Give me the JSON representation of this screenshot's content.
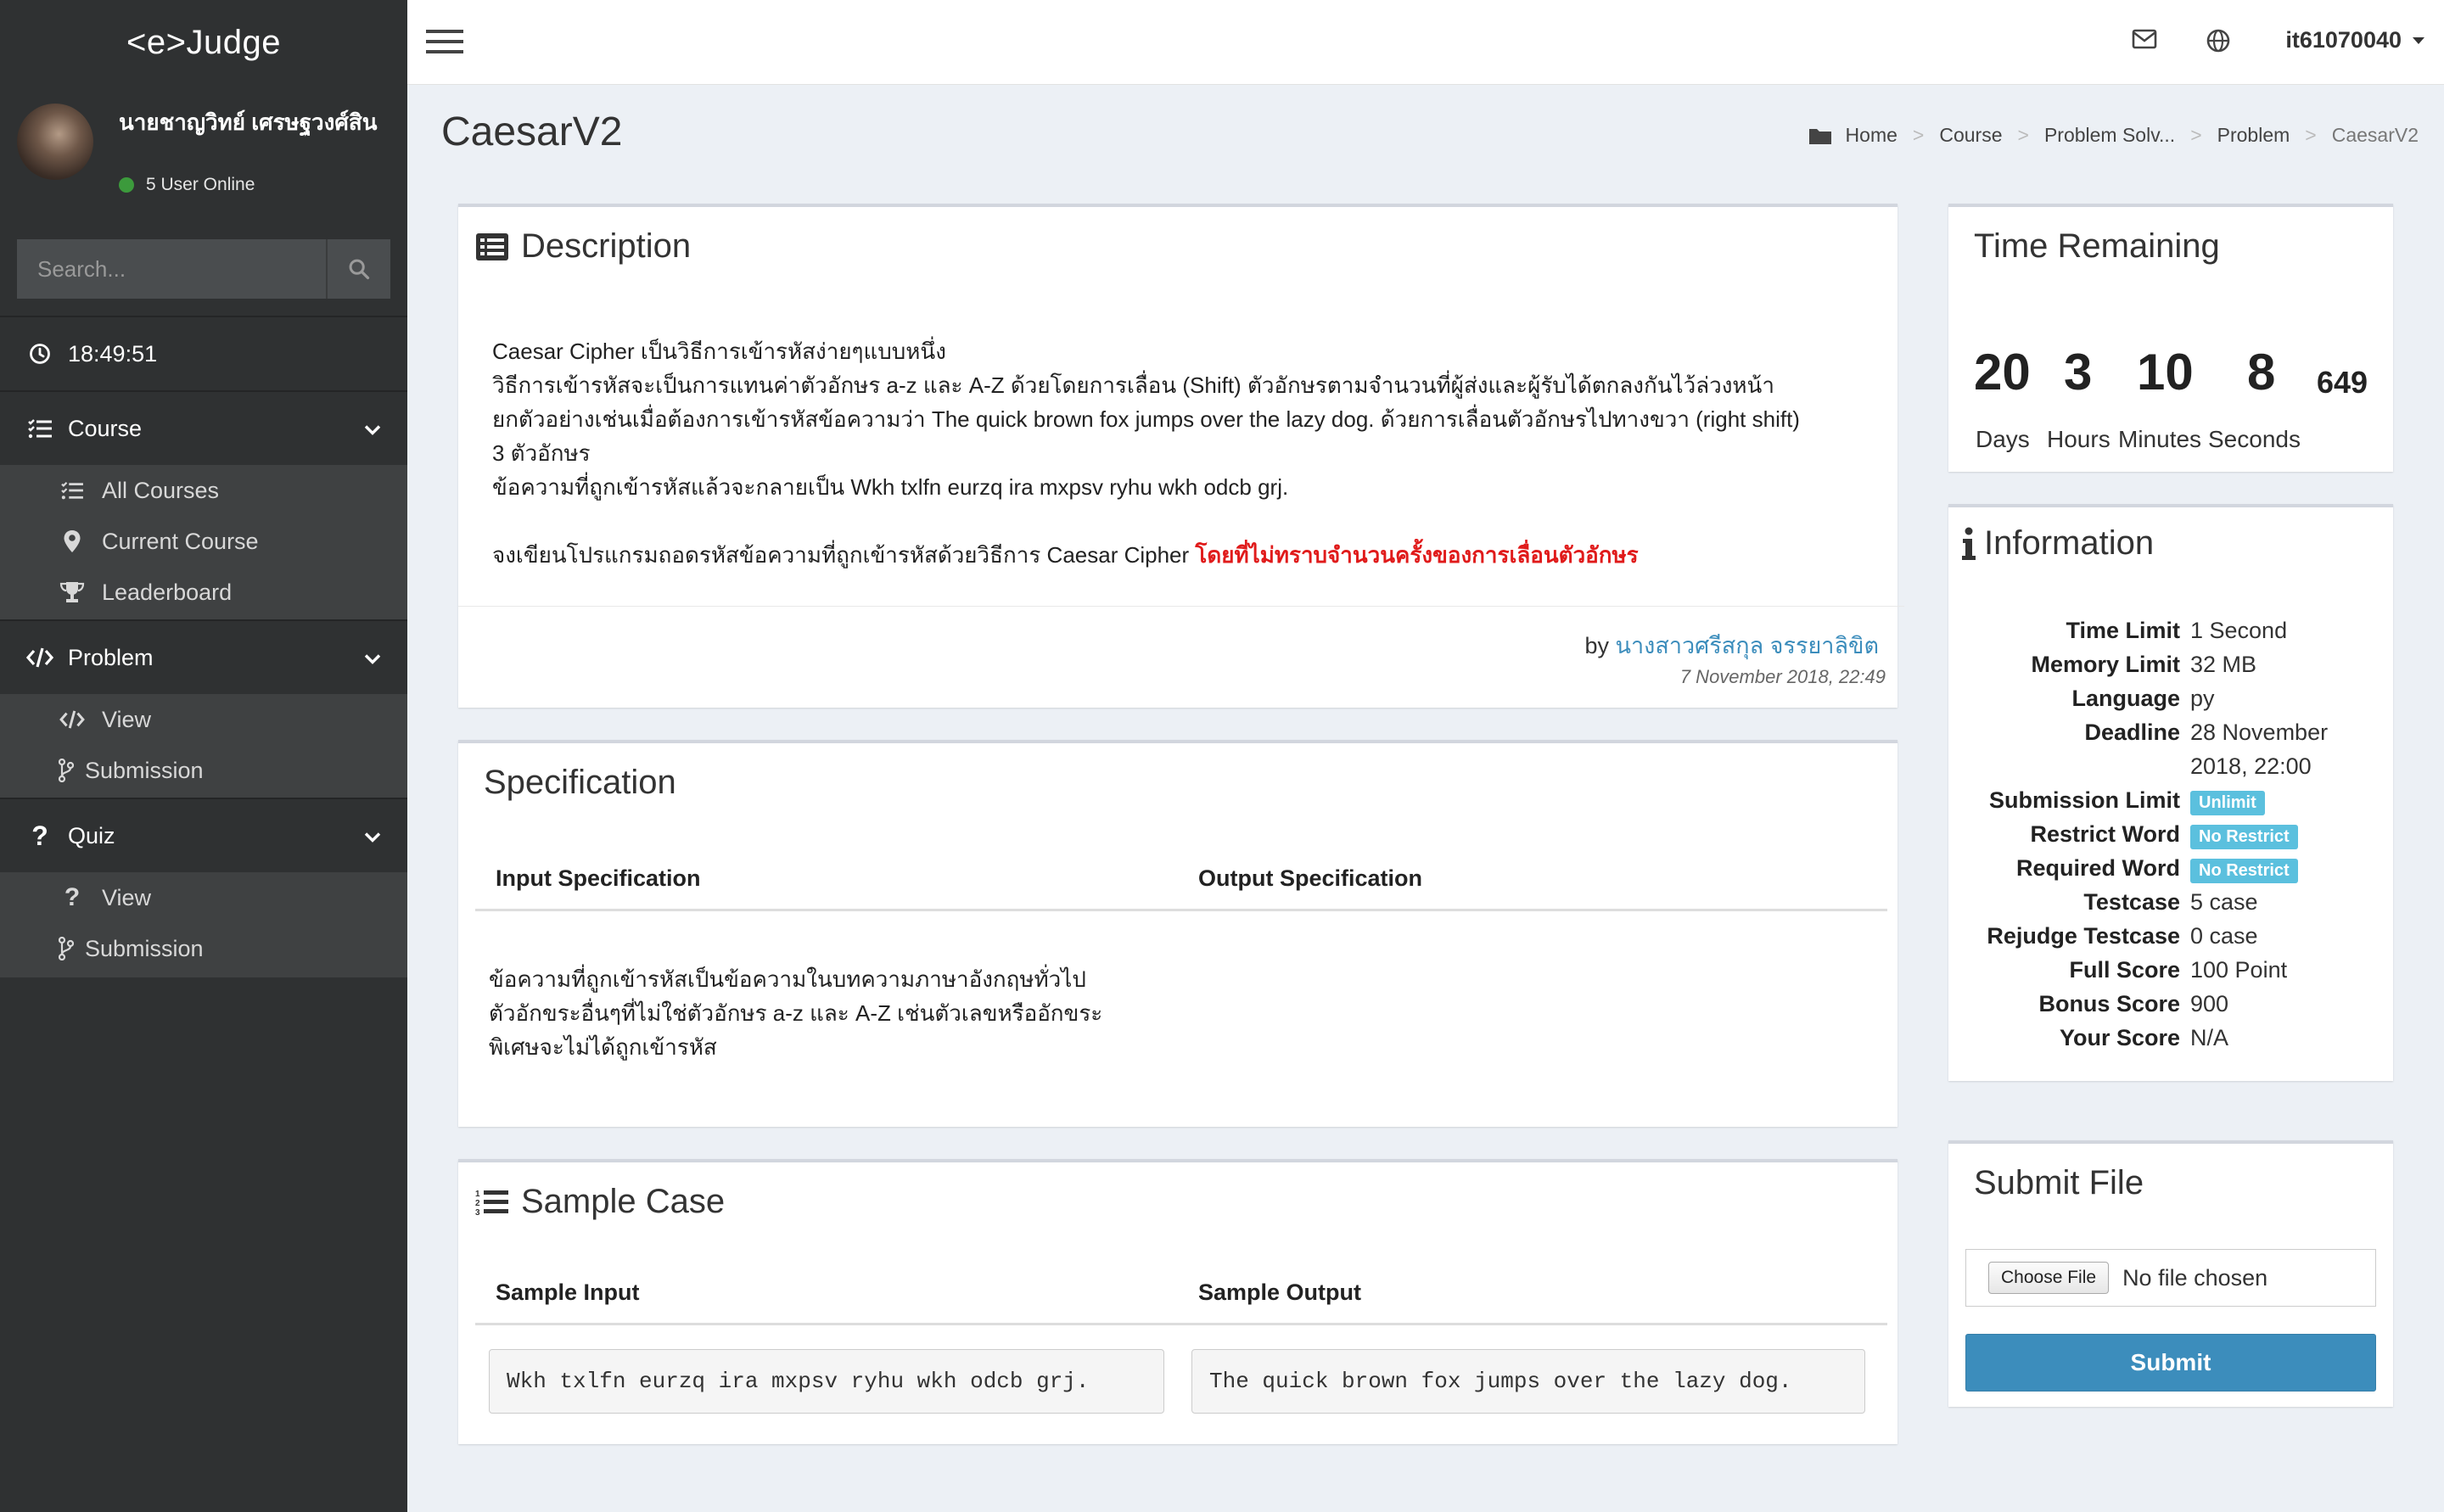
{
  "app": {
    "brand": "<e>Judge"
  },
  "user": {
    "name": "นายชาญวิทย์ เศรษฐวงศ์สิน",
    "status": "5 User Online",
    "menu_label": "it61070040"
  },
  "search": {
    "placeholder": "Search..."
  },
  "clock": "18:49:51",
  "sidebar": {
    "course": {
      "label": "Course",
      "items": [
        "All Courses",
        "Current Course",
        "Leaderboard"
      ]
    },
    "problem": {
      "label": "Problem",
      "items": [
        "View",
        "Submission"
      ]
    },
    "quiz": {
      "label": "Quiz",
      "items": [
        "View",
        "Submission"
      ]
    }
  },
  "page": {
    "title": "CaesarV2"
  },
  "breadcrumb": [
    "Home",
    "Course",
    "Problem Solv...",
    "Problem",
    "CaesarV2"
  ],
  "description": {
    "title": "Description",
    "lines": [
      "Caesar Cipher เป็นวิธีการเข้ารหัสง่ายๆแบบหนึ่ง",
      "วิธีการเข้ารหัสจะเป็นการแทนค่าตัวอักษร a-z และ A-Z ด้วยโดยการเลื่อน (Shift) ตัวอักษรตามจำนวนที่ผู้ส่งและผู้รับได้ตกลงกันไว้ล่วงหน้า",
      "ยกตัวอย่างเช่นเมื่อต้องการเข้ารหัสข้อความว่า The quick brown fox jumps over the lazy dog. ด้วยการเลื่อนตัวอักษรไปทางขวา (right shift)",
      "3 ตัวอักษร",
      "ข้อความที่ถูกเข้ารหัสแล้วจะกลายเป็น Wkh txlfn eurzq ira mxpsv ryhu wkh odcb grj."
    ],
    "task": "จงเขียนโปรแกรมถอดรหัสข้อความที่ถูกเข้ารหัสด้วยวิธีการ Caesar Cipher ",
    "task_emphasis": "โดยที่ไม่ทราบจำนวนครั้งของการเลื่อนตัวอักษร",
    "by_label": "by",
    "author": "นางสาวศรีสกุล จรรยาลิขิต",
    "date": "7 November 2018, 22:49"
  },
  "specification": {
    "title": "Specification",
    "input_header": "Input Specification",
    "output_header": "Output Specification",
    "input_lines": [
      "ข้อความที่ถูกเข้ารหัสเป็นข้อความในบทความภาษาอังกฤษทั่วไป",
      "ตัวอักขระอื่นๆที่ไม่ใช่ตัวอักษร a-z และ A-Z เช่นตัวเลขหรืออักขระ",
      "พิเศษจะไม่ได้ถูกเข้ารหัส"
    ]
  },
  "sample": {
    "title": "Sample Case",
    "input_header": "Sample Input",
    "output_header": "Sample Output",
    "input": "Wkh txlfn eurzq ira mxpsv ryhu wkh odcb grj.",
    "output": "The quick brown fox jumps over the lazy dog."
  },
  "time_remaining": {
    "title": "Time Remaining",
    "days": "20",
    "hours": "3",
    "minutes": "10",
    "seconds": "8",
    "ms": "649",
    "labels": [
      "Days",
      "Hours",
      "Minutes",
      "Seconds"
    ]
  },
  "information": {
    "title": "Information",
    "rows": [
      {
        "key": "Time Limit",
        "value": "1 Second"
      },
      {
        "key": "Memory Limit",
        "value": "32 MB"
      },
      {
        "key": "Language",
        "value": "py"
      },
      {
        "key": "Deadline",
        "value": "28 November",
        "value2": "2018, 22:00"
      },
      {
        "key": "Submission Limit",
        "badge": "Unlimit"
      },
      {
        "key": "Restrict Word",
        "badge": "No Restrict"
      },
      {
        "key": "Required Word",
        "badge": "No Restrict"
      },
      {
        "key": "Testcase",
        "value": "5 case"
      },
      {
        "key": "Rejudge Testcase",
        "value": "0 case"
      },
      {
        "key": "Full Score",
        "value": "100 Point"
      },
      {
        "key": "Bonus Score",
        "value": "900"
      },
      {
        "key": "Your Score",
        "value": "N/A"
      }
    ]
  },
  "submit": {
    "title": "Submit File",
    "choose_label": "Choose File",
    "no_file": "No file chosen",
    "button": "Submit"
  },
  "colors": {
    "sidebar": "#2f3132",
    "submenu": "#3f4142",
    "accent": "#3c8dbc",
    "badge": "#5bc0de",
    "danger": "#e01b1b",
    "online": "#3c9a3c"
  }
}
